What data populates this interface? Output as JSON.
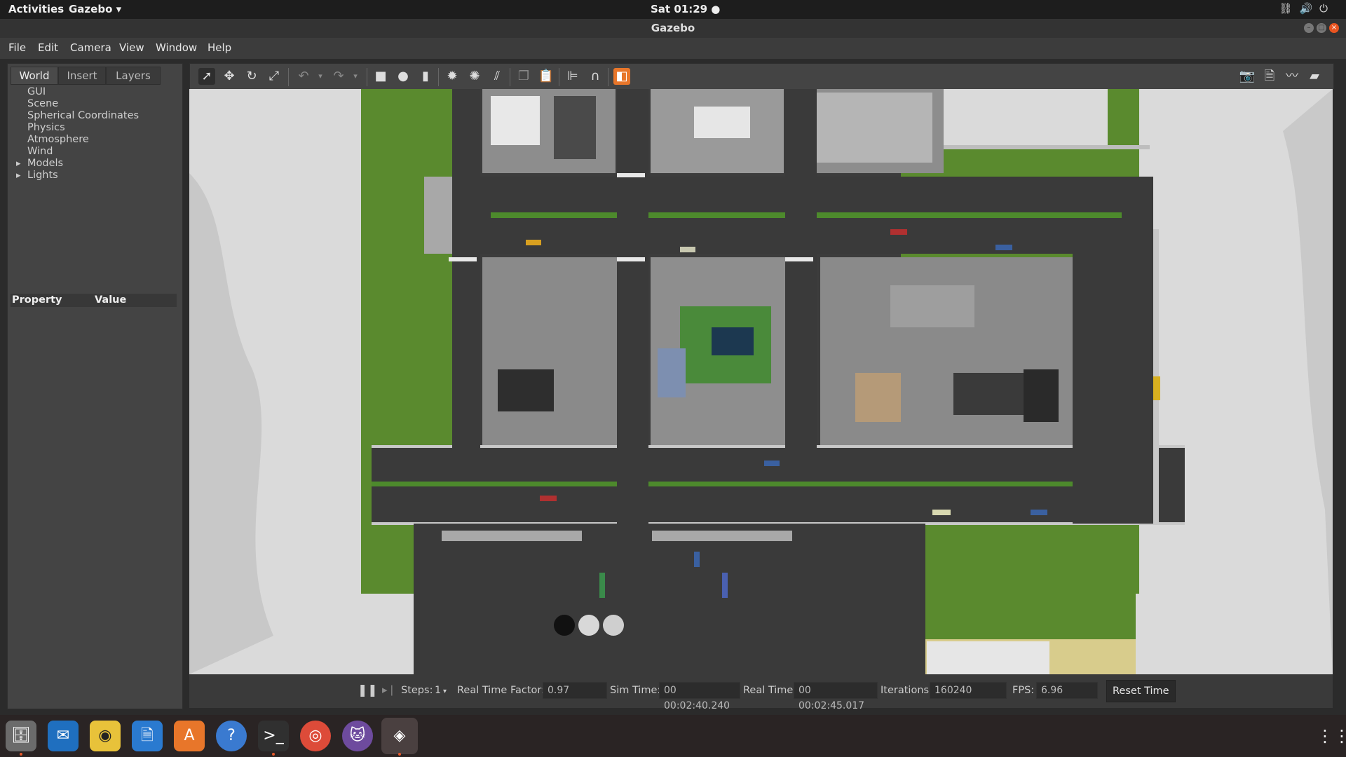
{
  "topbar": {
    "activities": "Activities",
    "app_menu": "Gazebo ▾",
    "clock": "Sat 01:29 ●"
  },
  "window": {
    "title": "Gazebo"
  },
  "menubar": {
    "items": [
      "File",
      "Edit",
      "Camera",
      "View",
      "Window",
      "Help"
    ]
  },
  "left_panel": {
    "tabs": [
      "World",
      "Insert",
      "Layers"
    ],
    "active_tab": "World",
    "tree": [
      "GUI",
      "Scene",
      "Spherical Coordinates",
      "Physics",
      "Atmosphere",
      "Wind",
      "Models",
      "Lights"
    ],
    "property_header": "Property",
    "value_header": "Value"
  },
  "toolbar": {
    "tools": [
      "select-mode",
      "translate-mode",
      "rotate-mode",
      "scale-mode",
      "undo",
      "redo",
      "box",
      "sphere",
      "cylinder",
      "point-light",
      "spot-light",
      "directional-light",
      "copy",
      "paste",
      "align",
      "snap",
      "view-angle"
    ],
    "right_tools": [
      "screenshot",
      "record-log",
      "plot",
      "video-record"
    ]
  },
  "bottom_bar": {
    "steps_label": "Steps:",
    "steps_value": "1",
    "rtf_label": "Real Time Factor:",
    "rtf_value": "0.97",
    "sim_time_label": "Sim Time:",
    "sim_time_value": "00 00:02:40.240",
    "real_time_label": "Real Time:",
    "real_time_value": "00 00:02:45.017",
    "iterations_label": "Iterations:",
    "iterations_value": "160240",
    "fps_label": "FPS:",
    "fps_value": "6.96",
    "reset_label": "Reset Time"
  },
  "dock": {
    "apps": [
      "files",
      "thunderbird",
      "rhythmbox",
      "libreoffice-writer",
      "software-center",
      "help",
      "terminal",
      "chrome",
      "github-desktop",
      "gazebo"
    ]
  },
  "colors": {
    "grass": "#5a8a2e",
    "road": "#3a3a3a",
    "lot": "#8e8e8e",
    "sky": "#e0e0e0",
    "sand": "#d8cc8c"
  }
}
